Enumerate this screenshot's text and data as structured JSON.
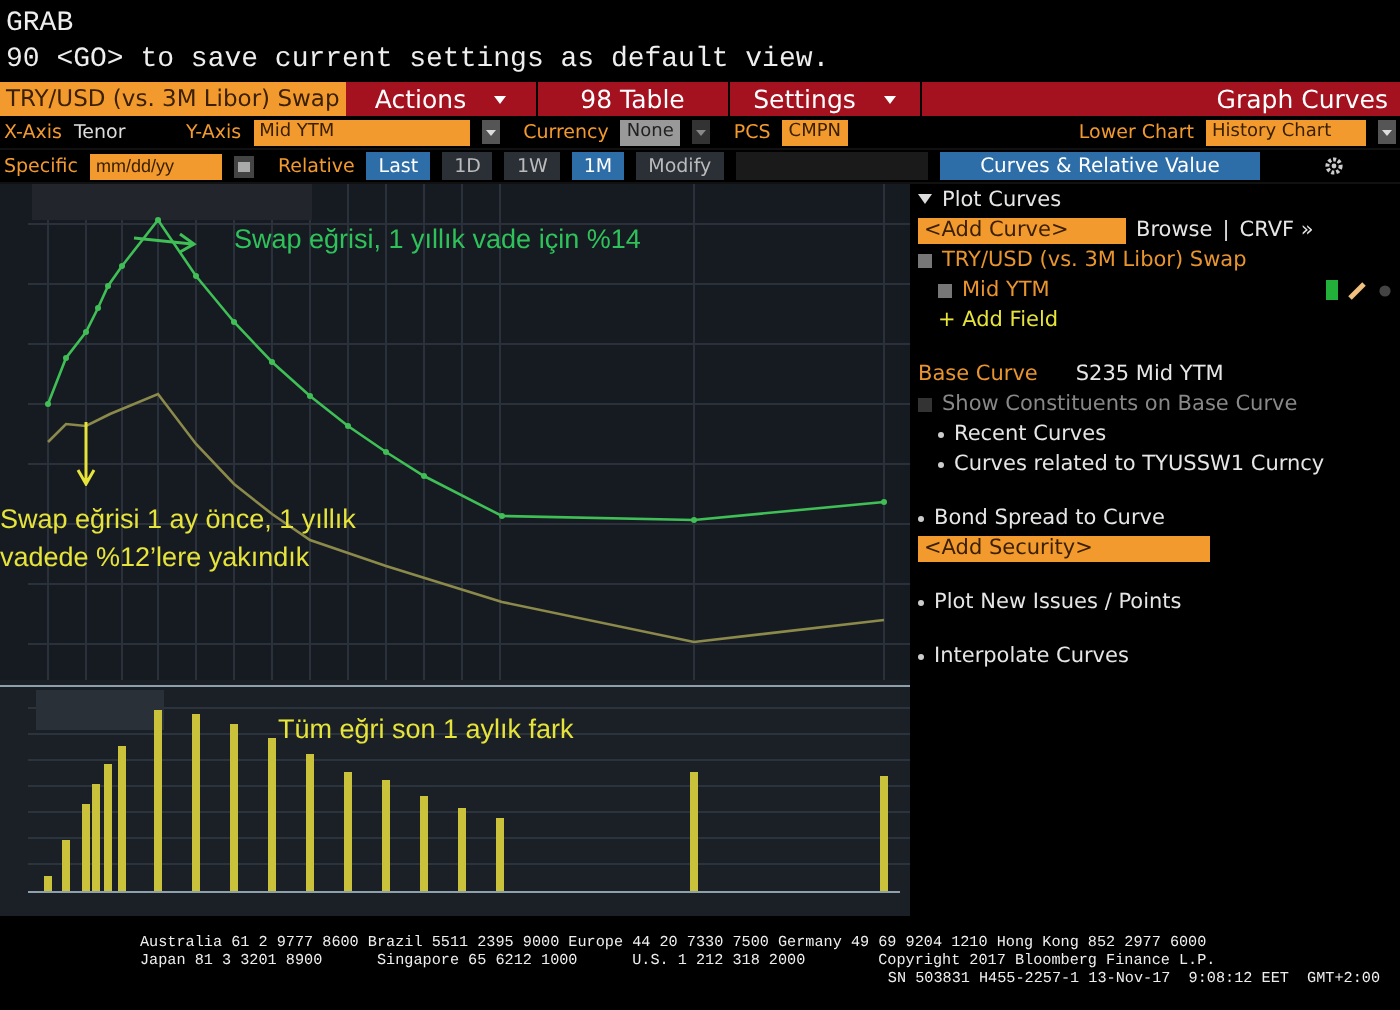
{
  "command_lines": [
    "GRAB",
    "90 <GO> to save current settings as default view."
  ],
  "title_bar": {
    "security": "TRY/USD (vs. 3M Libor) Swap",
    "menus": [
      {
        "label": "Actions",
        "dropdown": true
      },
      {
        "label": "98 Table",
        "dropdown": false
      },
      {
        "label": "Settings",
        "dropdown": true
      }
    ],
    "function": "Graph Curves"
  },
  "options": {
    "x_axis_label": "X-Axis",
    "x_axis_value": "Tenor",
    "y_axis_label": "Y-Axis",
    "y_axis_value": "Mid YTM",
    "currency_label": "Currency",
    "currency_value": "None",
    "currency_disabled": true,
    "pcs_label": "PCS",
    "pcs_value": "CMPN",
    "lower_chart_label": "Lower Chart",
    "lower_chart_value": "History Chart"
  },
  "dates": {
    "specific_label": "Specific",
    "date_placeholder": "mm/dd/yy",
    "relative_label": "Relative",
    "periods": [
      {
        "label": "Last",
        "selected": true
      },
      {
        "label": "1D",
        "selected": false
      },
      {
        "label": "1W",
        "selected": false
      },
      {
        "label": "1M",
        "selected": true
      },
      {
        "label": "Modify",
        "selected": false
      }
    ]
  },
  "panel_tab": {
    "label": "Curves & Relative Value",
    "selected": true
  },
  "annotations": {
    "current_curve": "Swap eğrisi, 1 yıllık vade için %14",
    "previous_curve": [
      "Swap eğrisi 1 ay önce, 1 yıllık",
      "vadede %12’lere yakındık"
    ],
    "difference": "Tüm eğri son 1 aylık fark"
  },
  "plot_curves": {
    "title": "Plot Curves",
    "expanded": true,
    "add_curve": "<Add Curve>",
    "browse": "Browse",
    "separator": "|",
    "crvf": "CRVF »",
    "curve": {
      "label": "TRY/USD (vs. 3M Libor) Swap",
      "checked": true
    },
    "field": {
      "label": "Mid YTM",
      "checked": true,
      "color": "#22b03a"
    },
    "add_field": "+ Add Field",
    "base_curve_label": "Base Curve",
    "base_curve_value": "S235 Mid YTM",
    "show_constituents": {
      "label": "Show Constituents on Base Curve",
      "checked": false
    },
    "links": [
      "Recent Curves",
      "Curves related to TYUSSW1 Curncy"
    ]
  },
  "sections": [
    {
      "label": "Bond Spread to Curve",
      "field": "<Add Security>"
    },
    {
      "label": "Plot New Issues / Points"
    },
    {
      "label": "Interpolate Curves"
    }
  ],
  "footer": [
    "Australia 61 2 9777 8600 Brazil 5511 2395 9000 Europe 44 20 7330 7500 Germany 49 69 9204 1210 Hong Kong 852 2977 6000",
    "Japan 81 3 3201 8900      Singapore 65 6212 1000      U.S. 1 212 318 2000        Copyright 2017 Bloomberg Finance L.P.",
    "SN 503831 H455-2257-1 13-Nov-17  9:08:12 EET  GMT+2:00"
  ]
}
